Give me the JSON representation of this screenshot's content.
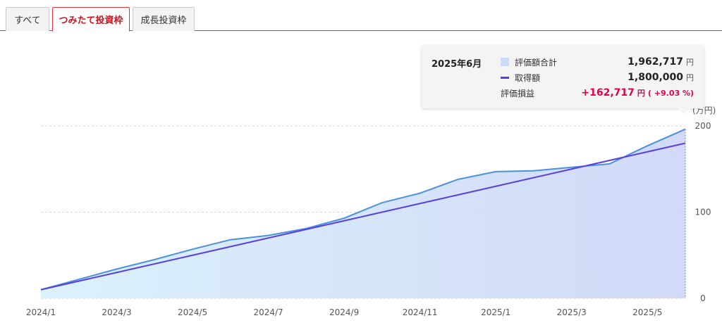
{
  "tabs": [
    {
      "label": "すべて",
      "active": false
    },
    {
      "label": "つみたて投資枠",
      "active": true
    },
    {
      "label": "成長投資枠",
      "active": false
    }
  ],
  "tooltip": {
    "month": "2025年6月",
    "valuation_label": "評価額合計",
    "valuation_value": "1,962,717",
    "cost_label": "取得額",
    "cost_value": "1,800,000",
    "gain_label": "評価損益",
    "gain_value": "+162,717",
    "gain_pct": "( +9.03 %)",
    "unit": "円"
  },
  "colors": {
    "valuation_line": "#4a90e2",
    "valuation_fill_start": "#d6f0fb",
    "valuation_fill_end": "#cdd5f7",
    "cost_line": "#5a3fe0",
    "gain": "#e0004d",
    "tab_accent": "#d9363e"
  },
  "chart_data": {
    "type": "area",
    "x": [
      "2024/1",
      "2024/2",
      "2024/3",
      "2024/4",
      "2024/5",
      "2024/6",
      "2024/7",
      "2024/8",
      "2024/9",
      "2024/10",
      "2024/11",
      "2024/12",
      "2025/1",
      "2025/2",
      "2025/3",
      "2025/4",
      "2025/5",
      "2025/6"
    ],
    "x_tick_labels": [
      "2024/1",
      "2024/3",
      "2024/5",
      "2024/7",
      "2024/9",
      "2024/11",
      "2025/1",
      "2025/3",
      "2025/5"
    ],
    "series": [
      {
        "name": "評価額合計",
        "kind": "area",
        "values": [
          10,
          22,
          34,
          45,
          57,
          68,
          73,
          81,
          93,
          111,
          122,
          138,
          147,
          148,
          152,
          156,
          177,
          196.2717
        ]
      },
      {
        "name": "取得額",
        "kind": "line",
        "values": [
          10,
          20,
          30,
          40,
          50,
          60,
          70,
          80,
          90,
          100,
          110,
          120,
          130,
          140,
          150,
          160,
          170,
          180
        ]
      }
    ],
    "y_unit": "(万円)",
    "y_ticks": [
      0,
      100,
      200
    ],
    "ylim": [
      0,
      200
    ],
    "grid": true,
    "y_axis_side": "right"
  }
}
